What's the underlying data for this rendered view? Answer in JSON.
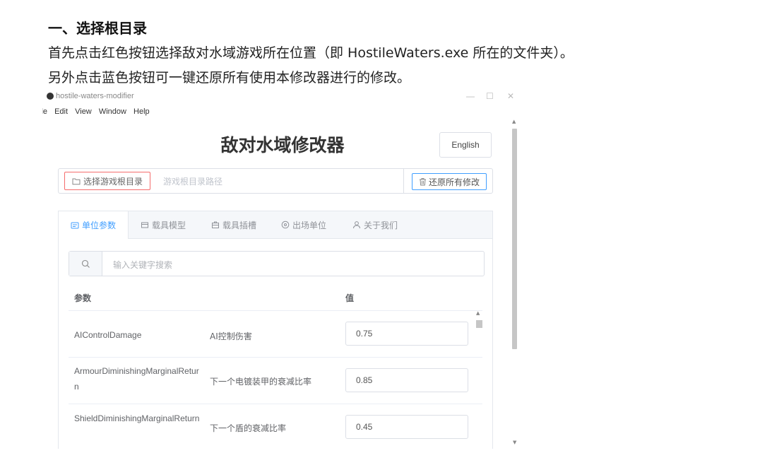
{
  "doc": {
    "heading": "一、选择根目录",
    "line1": "首先点击红色按钮选择敌对水域游戏所在位置（即 HostileWaters.exe 所在的文件夹）。",
    "line2": "另外点击蓝色按钮可一键还原所有使用本修改器进行的修改。"
  },
  "window": {
    "title": "hostile-waters-modifier",
    "controls": {
      "minimize": "—",
      "maximize": "☐",
      "close": "✕"
    },
    "menu": [
      "ile",
      "Edit",
      "View",
      "Window",
      "Help"
    ]
  },
  "app": {
    "title": "敌对水域修改器",
    "language_button": "English",
    "choose_root_button": "选择游戏根目录",
    "path_placeholder": "游戏根目录路径",
    "restore_button": "还原所有修改",
    "tabs": [
      {
        "label": "单位参数",
        "icon": "tag-icon"
      },
      {
        "label": "载具模型",
        "icon": "box-icon"
      },
      {
        "label": "载具插槽",
        "icon": "briefcase-icon"
      },
      {
        "label": "出场单位",
        "icon": "compass-icon"
      },
      {
        "label": "关于我们",
        "icon": "user-icon"
      }
    ],
    "active_tab": 0,
    "search_placeholder": "输入关键字搜索",
    "table": {
      "headers": [
        "参数",
        "值"
      ],
      "rows": [
        {
          "name": "AIControlDamage",
          "desc": "AI控制伤害",
          "value": "0.75"
        },
        {
          "name": "ArmourDiminishingMarginalReturn",
          "desc": "下一个电镀装甲的衰减比率",
          "value": "0.85"
        },
        {
          "name": "ShieldDiminishingMarginalReturn",
          "desc": "下一个盾的衰减比率",
          "value": "0.45"
        }
      ]
    }
  },
  "colors": {
    "accent": "#409eff",
    "danger": "#f56c6c",
    "border": "#dcdfe6"
  }
}
